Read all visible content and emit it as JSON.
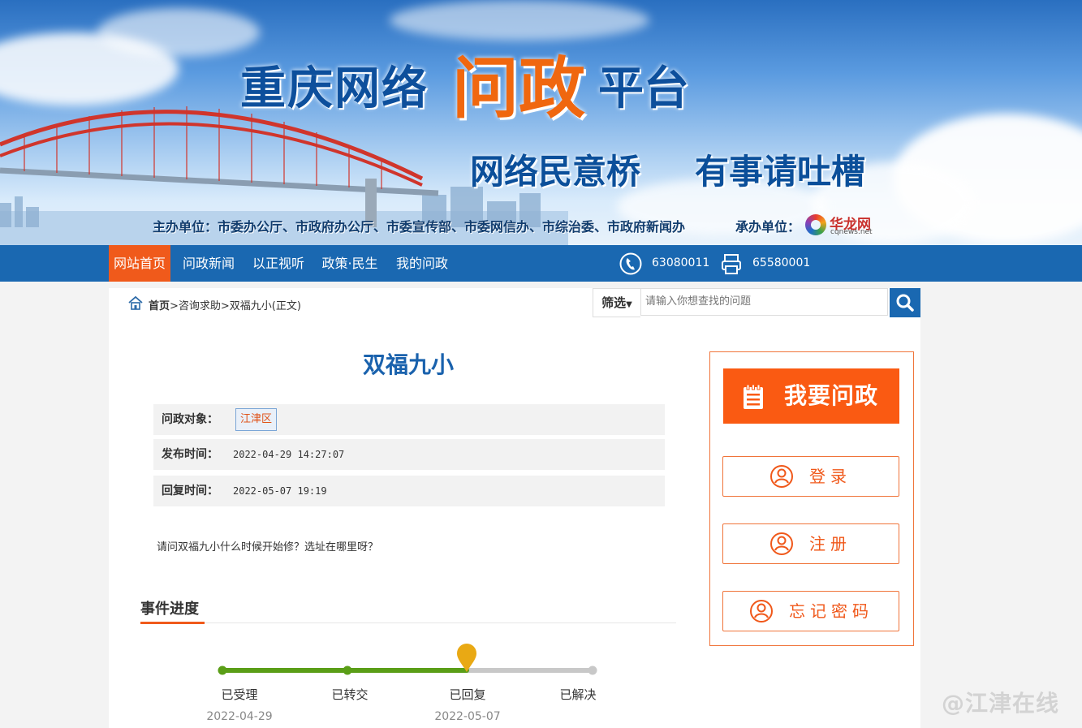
{
  "banner": {
    "title_prefix": "重庆网络",
    "title_highlight": "问政",
    "title_suffix": "平台",
    "slogan_1": "网络民意桥",
    "slogan_2": "有事请吐槽",
    "host_units": "主办单位：市委办公厅、市政府办公厅、市委宣传部、市委网信办、市综治委、市政府新闻办",
    "organizer_label": "承办单位：",
    "organizer_name": "华龙网",
    "organizer_domain": "cqnews.net"
  },
  "nav": {
    "items": [
      {
        "label": "网站首页",
        "active": true
      },
      {
        "label": "问政新闻",
        "active": false
      },
      {
        "label": "以正视听",
        "active": false
      },
      {
        "label": "政策·民生",
        "active": false
      },
      {
        "label": "我的问政",
        "active": false
      }
    ],
    "phone_number": "63080011",
    "fax_number": "65580001"
  },
  "breadcrumb": {
    "home": "首页",
    "path": ">咨询求助>双福九小(正文)"
  },
  "search": {
    "filter_label": "筛选",
    "placeholder": "请输入你想查找的问题"
  },
  "post": {
    "title": "双福九小",
    "target_label": "问政对象：",
    "target_value": "江津区",
    "published_label": "发布时间：",
    "published_value": "2022-04-29 14:27:07",
    "reply_label": "回复时间：",
    "reply_value": "2022-05-07 19:19",
    "content": "请问双福九小什么时候开始修？选址在哪里呀？"
  },
  "progress": {
    "section_title": "事件进度",
    "current_step": 2,
    "steps": [
      {
        "label": "已受理",
        "date": "2022-04-29"
      },
      {
        "label": "已转交",
        "date": ""
      },
      {
        "label": "已回复",
        "date": "2022-05-07"
      },
      {
        "label": "已解决",
        "date": ""
      }
    ],
    "color_done": "#5a9e17",
    "color_todo": "#c8c8c8",
    "color_marker": "#e9a914"
  },
  "sidebar": {
    "ask_label": "我要问政",
    "login_label": "登录",
    "register_label": "注册",
    "forgot_label": "忘记密码"
  },
  "watermark": "@江津在线",
  "colors": {
    "brand_blue": "#1a68b1",
    "accent_orange": "#f05a1b"
  }
}
